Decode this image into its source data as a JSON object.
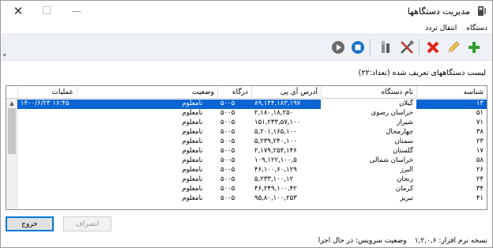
{
  "window": {
    "title": "مدیریت دستگاهها"
  },
  "menu": {
    "items": [
      "دستگاه",
      "انتقال تردد"
    ]
  },
  "toolbar": {
    "icons": [
      "add-icon",
      "edit-icon",
      "delete-icon",
      "tools-icon",
      "wrench-icon",
      "stop-icon",
      "play-icon"
    ],
    "colors": {
      "add": "#2f9e2f",
      "delete": "#e2231a",
      "stop": "#1a73c9",
      "play": "#6b6b6b"
    }
  },
  "caption": "لیست دستگاههای تعریف شده (تعداد:۲۲)",
  "grid": {
    "columns": {
      "id": "شناسه",
      "name": "نام دستگاه",
      "ip": "آدرس آی پی",
      "port": "درگاه",
      "status": "وضعیت",
      "ops": "عملیات"
    },
    "rows": [
      {
        "id": "۱۳",
        "name": "گیلان",
        "ip": "۸۹,۱۴۴,۱۸۳,۱۹۷",
        "port": "۵۰۰۵",
        "status": "نامعلوم",
        "ops": "۱۴۰۰/۶/۲۳ ۱۶:۴۵"
      },
      {
        "id": "۵۱",
        "name": "خراسان رضوی",
        "ip": "۲,۱۸۰,۱۸,۲۵۰",
        "port": "۵۰۰۵",
        "status": "نامعلوم",
        "ops": ""
      },
      {
        "id": "۷۱",
        "name": "شیراز",
        "ip": "۱۵۱,۲۳۳,۵۷,۱۰۰",
        "port": "۵۰۰۵",
        "status": "نامعلوم",
        "ops": ""
      },
      {
        "id": "۳۸",
        "name": "چهارمحال",
        "ip": "۵,۲۰۱,۱۶۵,۱۰۰",
        "port": "۵۰۰۵",
        "status": "نامعلوم",
        "ops": ""
      },
      {
        "id": "۲۳",
        "name": "سمنان",
        "ip": "۵,۲۳۹,۲۴۰,۱۰۰",
        "port": "۵۰۰۵",
        "status": "نامعلوم",
        "ops": ""
      },
      {
        "id": "۱۷",
        "name": "گلستان",
        "ip": "۲,۱۷۹,۲۵۴,۱۴۶",
        "port": "۵۰۰۵",
        "status": "نامعلوم",
        "ops": ""
      },
      {
        "id": "۵۸",
        "name": "خراسان شمالی",
        "ip": "۱۰۹,۱۲۲,۱۰۰,۵",
        "port": "۵۰۰۵",
        "status": "نامعلوم",
        "ops": ""
      },
      {
        "id": "۲۶",
        "name": "البرز",
        "ip": "۴۶,۱۰۰,۶۰,۱۲۹",
        "port": "۵۰۰۵",
        "status": "نامعلوم",
        "ops": ""
      },
      {
        "id": "۲۴",
        "name": "زنجان",
        "ip": "۵,۲۳۳,۱۰۰,۱۲",
        "port": "۵۰۰۵",
        "status": "نامعلوم",
        "ops": ""
      },
      {
        "id": "۳۴",
        "name": "کرمان",
        "ip": "۴۶,۲۴۹,۱۰۰,۴۲",
        "port": "۵۰۰۵",
        "status": "نامعلوم",
        "ops": ""
      },
      {
        "id": "۴۱",
        "name": "تبریز",
        "ip": "۹۵,۸۰,۱۰۰,۲۵۳",
        "port": "۵۰۰۵",
        "status": "نامعلوم",
        "ops": ""
      }
    ]
  },
  "buttons": {
    "exit": "خروج",
    "cancel": "انصراف"
  },
  "status": {
    "version": "نسخه نرم افزار: ۱,۲,۰,۶",
    "service": "وضعیت سرویس: در حال اجرا"
  }
}
